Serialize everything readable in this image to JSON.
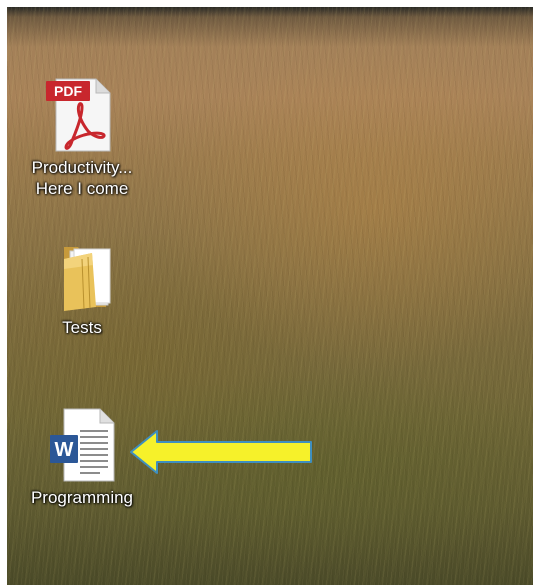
{
  "desktop": {
    "icons": [
      {
        "name": "pdf-file",
        "badge": "PDF",
        "label_line1": "Productivity...",
        "label_line2": "Here I come"
      },
      {
        "name": "folder",
        "label_line1": "Tests"
      },
      {
        "name": "word-document",
        "badge": "W",
        "label_line1": "Programming"
      }
    ],
    "arrow": {
      "direction": "left",
      "color": "#f6f12a"
    }
  },
  "colors": {
    "pdf_red": "#c8272d",
    "word_blue": "#2b5797",
    "folder_yellow": "#e9c25a"
  }
}
